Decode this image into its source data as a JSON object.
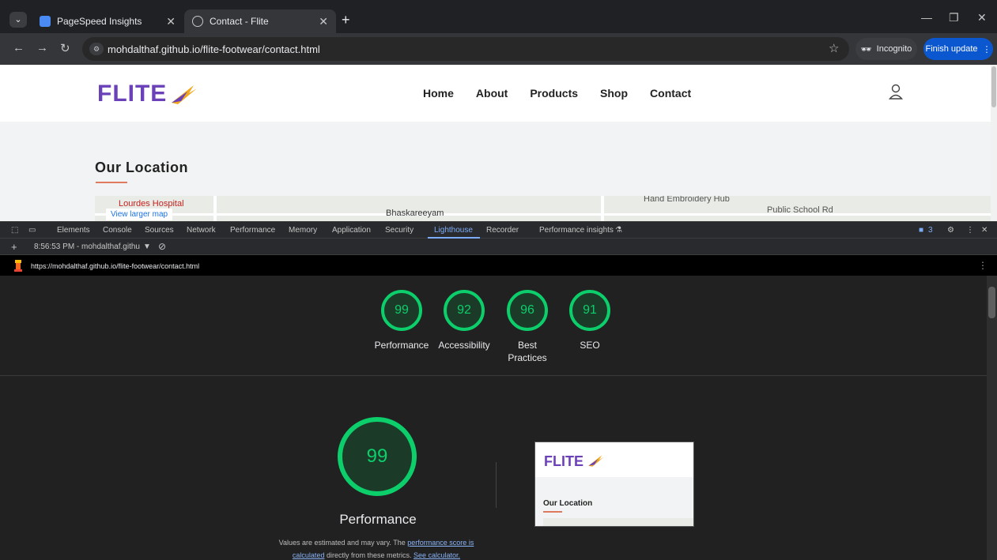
{
  "browser": {
    "tabs": [
      {
        "title": "PageSpeed Insights",
        "active": false
      },
      {
        "title": "Contact - Flite",
        "active": true
      }
    ],
    "url": "mohdalthaf.github.io/flite-footwear/contact.html",
    "incognito_label": "Incognito",
    "finish_update_label": "Finish update"
  },
  "site": {
    "logo": "FLITE",
    "nav": [
      "Home",
      "About",
      "Products",
      "Shop",
      "Contact"
    ],
    "section_title": "Our Location",
    "map": {
      "view_larger": "View larger map",
      "places": [
        "Lourdes Hospital",
        "Bhaskareeyam",
        "Hand Embroidery Hub",
        "Public School Rd"
      ]
    }
  },
  "devtools": {
    "tabs": [
      "Elements",
      "Console",
      "Sources",
      "Network",
      "Performance",
      "Memory",
      "Application",
      "Security",
      "Lighthouse",
      "Recorder",
      "Performance insights"
    ],
    "active_tab": "Lighthouse",
    "issues_count": "3",
    "session_label": "8:56:53 PM - mohdalthaf.githu",
    "report_url": "https://mohdalthaf.github.io/flite-footwear/contact.html"
  },
  "report": {
    "scores": [
      {
        "value": "99",
        "label": "Performance"
      },
      {
        "value": "92",
        "label": "Accessibility"
      },
      {
        "value": "96",
        "label": "Best Practices"
      },
      {
        "value": "91",
        "label": "SEO"
      }
    ],
    "main": {
      "value": "99",
      "label": "Performance",
      "note_prefix": "Values are estimated and may vary. The",
      "link1": "performance score is calculated",
      "note_middle": "directly from these metrics.",
      "link2": "See calculator."
    },
    "thumbnail": {
      "logo": "FLITE",
      "title": "Our Location"
    }
  },
  "colors": {
    "accent_green": "#0cce6b",
    "brand_purple": "#6a41b8",
    "link_blue": "#8ab4f8"
  }
}
